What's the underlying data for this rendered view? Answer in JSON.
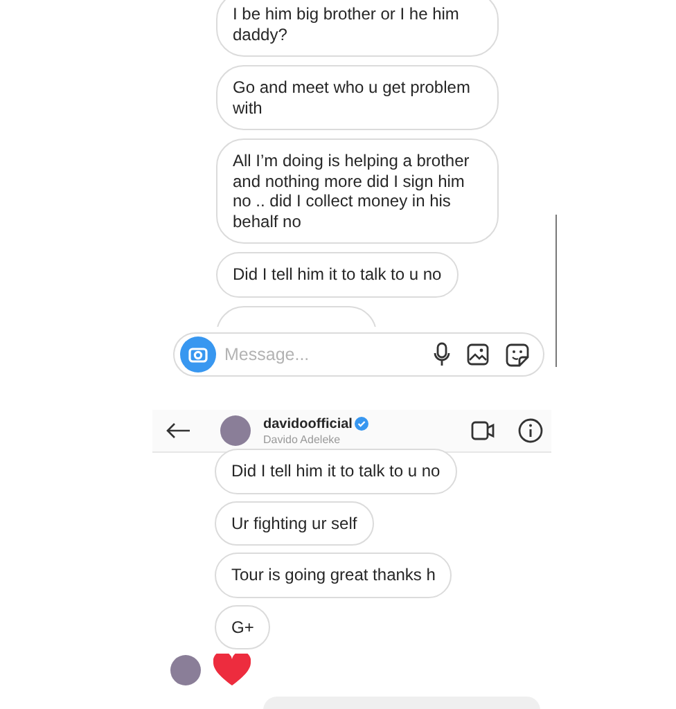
{
  "top_thread": {
    "messages": [
      {
        "kind": "text",
        "text": "I be him big brother or I he him daddy?"
      },
      {
        "kind": "text",
        "text": "Go and meet who u get problem with"
      },
      {
        "kind": "text",
        "text": "All I’m doing is helping a brother and nothing more did I sign him no .. did I collect money in his behalf no"
      },
      {
        "kind": "text",
        "text": "Did I tell him it to talk to u no"
      },
      {
        "kind": "cut"
      }
    ]
  },
  "composer": {
    "placeholder": "Message..."
  },
  "header": {
    "username": "davidoofficial",
    "verified": true,
    "full_name": "Davido Adeleke"
  },
  "bottom_thread": {
    "messages": [
      {
        "kind": "text",
        "text": "Did I tell him it to talk to u no"
      },
      {
        "kind": "text",
        "text": "Ur fighting ur self"
      },
      {
        "kind": "text",
        "text": "Tour is going great thanks h"
      },
      {
        "kind": "text",
        "text": "G+"
      },
      {
        "kind": "heart_reaction"
      },
      {
        "kind": "outgoing"
      }
    ]
  }
}
